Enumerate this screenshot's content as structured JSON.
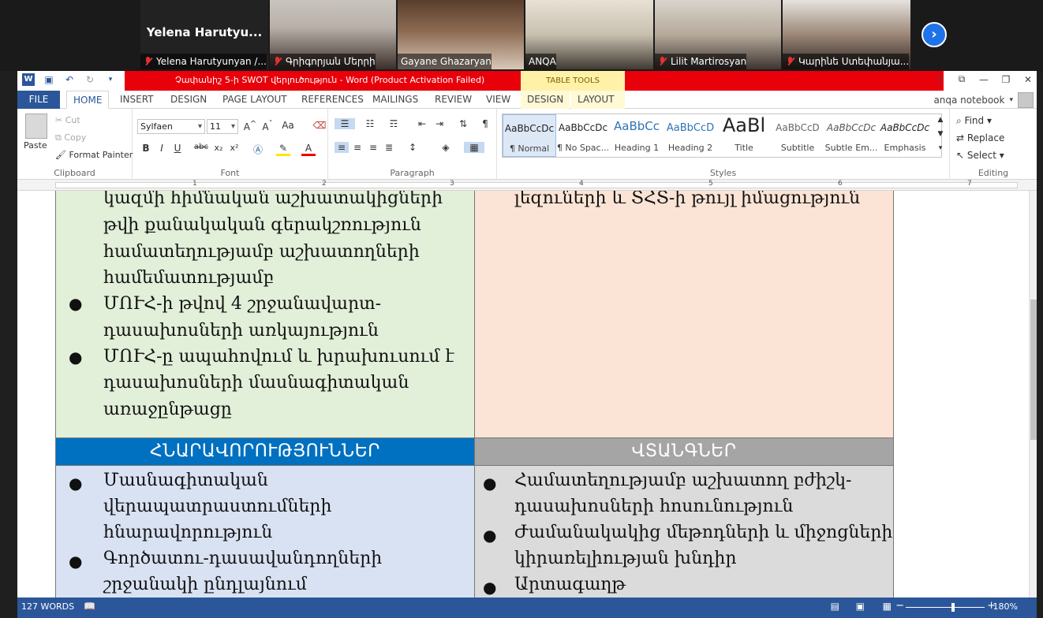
{
  "zoom": {
    "participants": [
      {
        "name": "Yelena Harutyunyan /...",
        "big_name": "Yelena  Harutyu...",
        "muted": true
      },
      {
        "name": "Գրիգորյան Մերրի",
        "muted": true
      },
      {
        "name": "Gayane Ghazaryan",
        "muted": false
      },
      {
        "name": "ANQA",
        "muted": false
      },
      {
        "name": "Lilit Martirosyan",
        "muted": true
      },
      {
        "name": "Կարինե Ստեփանյա...",
        "muted": true
      }
    ],
    "next_label": "›"
  },
  "word": {
    "doc_title": "Չափանիշ 5-ի SWOT վերլուծություն -  Word (Product Activation Failed)",
    "table_tools": "TABLE TOOLS",
    "tabs": [
      "FILE",
      "HOME",
      "INSERT",
      "DESIGN",
      "PAGE LAYOUT",
      "REFERENCES",
      "MAILINGS",
      "REVIEW",
      "VIEW",
      "DESIGN",
      "LAYOUT"
    ],
    "account": "anqa notebook",
    "win": {
      "help": "?",
      "restore": "⧉",
      "min": "—",
      "max": "❐",
      "close": "✕"
    },
    "clipboard": {
      "paste": "Paste",
      "cut": "Cut",
      "copy": "Copy",
      "format_painter": "Format Painter",
      "label": "Clipboard"
    },
    "font": {
      "name": "Sylfaen",
      "size": "11",
      "label": "Font"
    },
    "paragraph": {
      "label": "Paragraph"
    },
    "styles": {
      "label": "Styles",
      "items": [
        {
          "sample": "AaBbCcDc",
          "name": "¶ Normal"
        },
        {
          "sample": "AaBbCcDc",
          "name": "¶ No Spac..."
        },
        {
          "sample": "AaBbCc",
          "name": "Heading 1"
        },
        {
          "sample": "AaBbCcD",
          "name": "Heading 2"
        },
        {
          "sample": "AaBl",
          "name": "Title"
        },
        {
          "sample": "AaBbCcD",
          "name": "Subtitle"
        },
        {
          "sample": "AaBbCcDc",
          "name": "Subtle Em..."
        },
        {
          "sample": "AaBbCcDc",
          "name": "Emphasis"
        }
      ]
    },
    "editing": {
      "find": "Find",
      "replace": "Replace",
      "select": "Select",
      "label": "Editing"
    },
    "ruler_numbers": [
      "1",
      "2",
      "3",
      "4",
      "5",
      "6",
      "7"
    ],
    "table": {
      "strengths_lines": [
        "կազմի հիմնական աշխատակիցների",
        "թվի քանակական գերակշռություն",
        "համատեղությամբ աշխատողների",
        "համեմատությամբ",
        "ՄՈՒՀ-ի թվով 4 շրջանավարտ-",
        "դասախոսների առկայություն",
        "ՄՈՒՀ-ը ապահովում և խրախուսում է",
        "դասախոսների մասնագիտական",
        "առաջընթացը"
      ],
      "weaknesses_lines": [
        "լեզուների և ՏՀՏ-ի թույլ իմացություն"
      ],
      "opportunities_header": "ՀՆԱՐԱՎՈՐՈՒԹՅՈՒՆՆԵՐ",
      "threats_header": "ՎՏԱՆԳՆԵՐ",
      "opportunities_lines": [
        "Մասնագիտական",
        "վերապատրաստումների",
        "հնարավորություն",
        "Գործատու-դասավանդողների",
        "շրջանակի ընդլայնում"
      ],
      "threats_lines": [
        "Համատեղությամբ աշխատող բժիշկ-",
        "դասախոսների հոսունություն",
        "Ժամանակակից մեթոդների և միջոցների",
        "կիրառելիության խնդիր",
        "Արտագաղթ"
      ]
    },
    "status": {
      "words": "127 WORDS",
      "zoom": "180%"
    }
  }
}
